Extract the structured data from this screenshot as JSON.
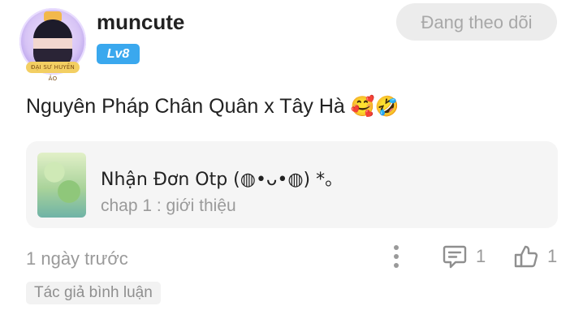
{
  "user": {
    "username": "muncute",
    "level": "Lv8",
    "avatar_banner": "ĐẠI SƯ HUYỀN ẢO"
  },
  "actions": {
    "follow_label": "Đang theo dõi"
  },
  "comment": {
    "text": "Nguyên Pháp Chân Quân x Tây Hà",
    "emojis": "🥰🤣",
    "timestamp": "1 ngày trước",
    "reply_count": "1",
    "like_count": "1",
    "author_tag": "Tác giả bình luận"
  },
  "story": {
    "title": "Nhận Đơn Otp (◍•ᴗ•◍) *。",
    "chapter": "chap 1 : giới thiệu"
  },
  "icons": {
    "more": "more-vertical-icon",
    "reply": "comment-icon",
    "like": "thumbs-up-icon"
  },
  "colors": {
    "level_badge": "#3aa8ee",
    "follow_bg": "#ececec",
    "muted_text": "#9a9a9a",
    "card_bg": "#f5f5f5"
  }
}
